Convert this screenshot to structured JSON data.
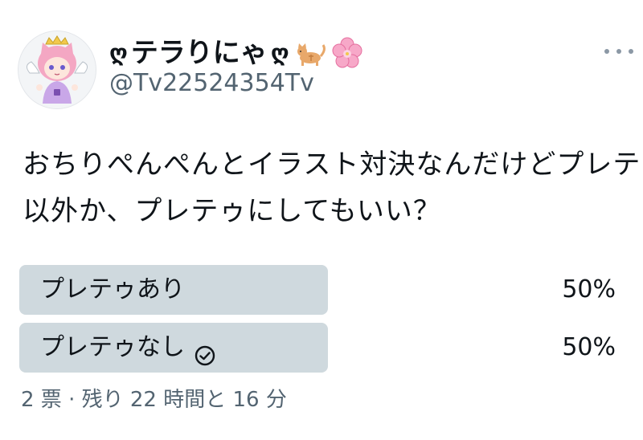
{
  "user": {
    "deco_left": "ღ",
    "name": "テラりにゃ",
    "deco_right": "ღ",
    "emoji_1": "cat-emoji",
    "emoji_2": "cherry-blossom-emoji",
    "handle": "@Tv22524354Tv"
  },
  "tweet": {
    "text_line_1": "おちりぺんぺんとイラスト対決なんだけどプレテゥ",
    "text_line_2": "以外か、プレテゥにしてもいい？"
  },
  "poll": {
    "options": [
      {
        "label": "プレテゥあり",
        "percent_text": "50%",
        "share": 0.5,
        "selected": false
      },
      {
        "label": "プレテゥなし",
        "percent_text": "50%",
        "share": 0.5,
        "selected": true
      }
    ],
    "meta": "2 票 · 残り 22 時間と 16 分"
  },
  "colors": {
    "bar": "#cfd9de",
    "secondary_text": "#536471",
    "primary_text": "#0f1419"
  },
  "icons": {
    "more": "more-icon",
    "check": "check-circle-icon"
  }
}
